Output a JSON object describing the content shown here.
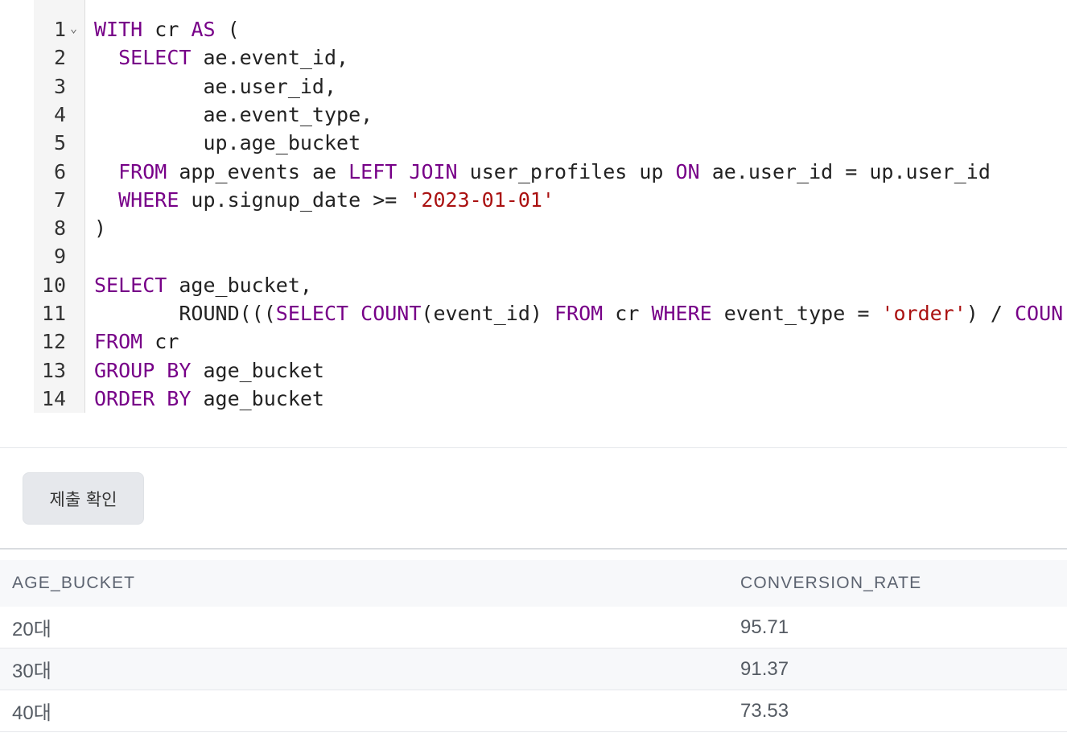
{
  "editor": {
    "line_numbers": [
      "1",
      "2",
      "3",
      "4",
      "5",
      "6",
      "7",
      "8",
      "9",
      "10",
      "11",
      "12",
      "13",
      "14"
    ],
    "fold_marker": "⌄",
    "lines": [
      [
        {
          "t": "WITH",
          "k": "kw"
        },
        {
          "t": " cr "
        },
        {
          "t": "AS",
          "k": "kw"
        },
        {
          "t": " ("
        }
      ],
      [
        {
          "t": "  "
        },
        {
          "t": "SELECT",
          "k": "kw"
        },
        {
          "t": " ae.event_id,"
        }
      ],
      [
        {
          "t": "         ae.user_id,"
        }
      ],
      [
        {
          "t": "         ae.event_type,"
        }
      ],
      [
        {
          "t": "         up.age_bucket"
        }
      ],
      [
        {
          "t": "  "
        },
        {
          "t": "FROM",
          "k": "kw"
        },
        {
          "t": " app_events ae "
        },
        {
          "t": "LEFT",
          "k": "kw"
        },
        {
          "t": " "
        },
        {
          "t": "JOIN",
          "k": "kw"
        },
        {
          "t": " user_profiles up "
        },
        {
          "t": "ON",
          "k": "kw"
        },
        {
          "t": " ae.user_id = up.user_id"
        }
      ],
      [
        {
          "t": "  "
        },
        {
          "t": "WHERE",
          "k": "kw"
        },
        {
          "t": " up.signup_date >= "
        },
        {
          "t": "'2023-01-01'",
          "k": "str"
        }
      ],
      [
        {
          "t": ")"
        }
      ],
      [
        {
          "t": ""
        }
      ],
      [
        {
          "t": "SELECT",
          "k": "kw"
        },
        {
          "t": " age_bucket,"
        }
      ],
      [
        {
          "t": "       ROUND((("
        },
        {
          "t": "SELECT",
          "k": "kw"
        },
        {
          "t": " "
        },
        {
          "t": "COUNT",
          "k": "kw"
        },
        {
          "t": "(event_id) "
        },
        {
          "t": "FROM",
          "k": "kw"
        },
        {
          "t": " cr "
        },
        {
          "t": "WHERE",
          "k": "kw"
        },
        {
          "t": " event_type = "
        },
        {
          "t": "'order'",
          "k": "str"
        },
        {
          "t": ") / "
        },
        {
          "t": "COUN",
          "k": "kw"
        }
      ],
      [
        {
          "t": "FROM",
          "k": "kw"
        },
        {
          "t": " cr"
        }
      ],
      [
        {
          "t": "GROUP BY",
          "k": "kw"
        },
        {
          "t": " age_bucket"
        }
      ],
      [
        {
          "t": "ORDER BY",
          "k": "kw"
        },
        {
          "t": " age_bucket"
        }
      ]
    ]
  },
  "actions": {
    "submit_label": "제출 확인"
  },
  "results": {
    "columns": [
      "AGE_BUCKET",
      "CONVERSION_RATE"
    ],
    "rows": [
      [
        "20대",
        "95.71"
      ],
      [
        "30대",
        "91.37"
      ],
      [
        "40대",
        "73.53"
      ]
    ]
  }
}
